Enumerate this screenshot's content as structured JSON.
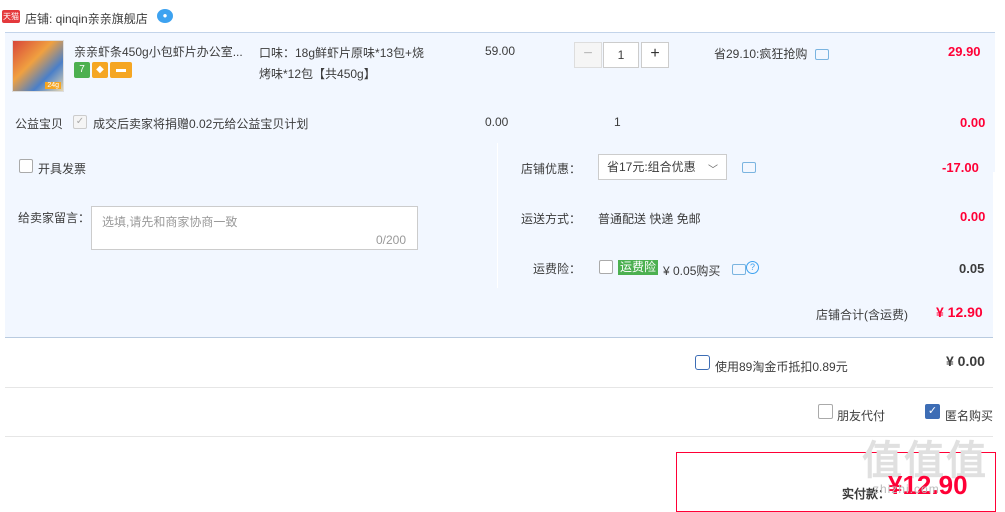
{
  "store": {
    "tmall_logo": "天猫",
    "label": "店铺: qinqin亲亲旗舰店",
    "ww_badge": "ww-icon"
  },
  "item": {
    "image_badge": "24g",
    "title": "亲亲虾条450g小包虾片办公室...",
    "badges": {
      "seven": "7"
    },
    "sku_line1": "口味：18g鲜虾片原味*13包+烧",
    "sku_line2": "烤味*12包【共450g】",
    "price": "59.00",
    "qty_minus": "−",
    "qty": "1",
    "qty_plus": "+",
    "promo": "省29.10:疯狂抢购",
    "subtotal": "29.90"
  },
  "charity": {
    "label": "公益宝贝",
    "check": "✓",
    "text": "成交后卖家将捐赠0.02元给公益宝贝计划",
    "price": "0.00",
    "qty": "1",
    "total": "0.00"
  },
  "invoice": {
    "label": "开具发票"
  },
  "message": {
    "label": "给卖家留言：",
    "placeholder": "选填,请先和商家协商一致",
    "count": "0/200"
  },
  "coupon": {
    "label": "店铺优惠：",
    "selected": "省17元:组合优惠",
    "chevron": "﹀",
    "amount": "-17.00"
  },
  "shipping": {
    "label": "运送方式：",
    "text": "普通配送 快递 免邮",
    "amount": "0.00"
  },
  "insurance": {
    "label": "运费险：",
    "tag": "运费险",
    "price": "¥ 0.05购买",
    "help": "?",
    "amount": "0.05"
  },
  "store_total": {
    "label": "店铺合计(含运费)",
    "amount": "¥ 12.90"
  },
  "coins": {
    "label": "使用89淘金币抵扣0.89元",
    "amount": "¥ 0.00"
  },
  "options": {
    "friend_pay": "朋友代付",
    "anonymous": "匿名购买",
    "anon_check": "✓"
  },
  "payment": {
    "label": "实付款：",
    "amount": "¥12.90"
  },
  "watermark": {
    "text": "值值值",
    "url": "zhizhi.com"
  },
  "colors": {
    "accent_red": "#ff0036",
    "panel_blue": "#f2f7ff",
    "check_blue": "#3d6db5",
    "tag_green": "#4cb050"
  }
}
